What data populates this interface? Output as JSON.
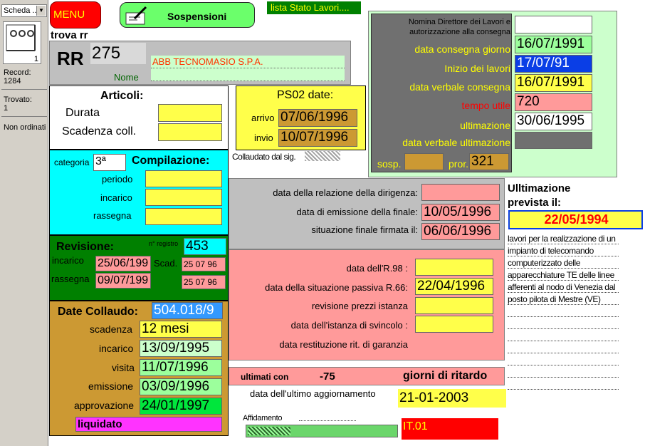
{
  "sidebar": {
    "selector": "Scheda ...",
    "page_number": "1",
    "record_label": "Record:",
    "record_value": "1284",
    "trovato_label": "Trovato:",
    "trovato_value": "1",
    "sort_label": "Non ordinati"
  },
  "header": {
    "menu_label": "MENU",
    "sospensioni_label": "Sospensioni",
    "lista_label": "lista Stato Lavori....",
    "trova_label": "trova rr",
    "rr_label": "RR",
    "rr_value": "275",
    "company": "ABB TECNOMASIO S.P.A.",
    "nome_label": "Nome"
  },
  "articoli": {
    "title": "Articoli:",
    "durata_label": "Durata",
    "durata_value": "",
    "scadenza_label": "Scadenza coll.",
    "scadenza_value": ""
  },
  "ps02": {
    "title": "PS02 date:",
    "arrivo_label": "arrivo",
    "arrivo_value": "07/06/1996",
    "invio_label": "invio",
    "invio_value": "10/07/1996",
    "collaudato_label": "Collaudato dal sig."
  },
  "direttore": {
    "nomina_label": "Nomina Direttore dei Lavori e autorizzazione alla consegna",
    "nomina_value": "",
    "consegna_label": "data consegna giorno",
    "consegna_value": "16/07/1991",
    "inizio_label": "Inizio dei lavori",
    "inizio_value": "17/07/91",
    "verbale_label": "data verbale consegna",
    "verbale_value": "16/07/1991",
    "tempo_label": "tempo utile",
    "tempo_value": "720",
    "ultimazione_label": "ultimazione",
    "ultimazione_value": "30/06/1995",
    "verbale_ult_label": "data verbale ultimazione",
    "verbale_ult_value": "",
    "sosp_label": "sosp.",
    "sosp_value": "",
    "pror_label": "pror.",
    "pror_value": "321"
  },
  "compilazione": {
    "categoria_label": "categoria",
    "categoria_value": "3ª",
    "title": "Compilazione:",
    "periodo_label": "periodo",
    "periodo_value": "",
    "incarico_label": "incarico",
    "incarico_value": "",
    "rassegna_label": "rassegna",
    "rassegna_value": ""
  },
  "relazione": {
    "dirigenza_label": "data della relazione della dirigenza:",
    "dirigenza_value": "",
    "emissione_label": "data di emissione della finale:",
    "emissione_value": "10/05/1996",
    "firmata_label": "situazione finale firmata il:",
    "firmata_value": "06/06/1996"
  },
  "ultimazione_prevista": {
    "title": "Ulltimazione prevista  il:",
    "value": "22/05/1994",
    "description": "lavori per la realizzazione di un impianto di telecomando computerizzato delle apparecchiature TE delle linee afferenti al nodo di Venezia dal posto pilota di Mestre (VE)"
  },
  "revisione": {
    "title": "Revisione:",
    "registro_label": "n° registro",
    "registro_value": "453",
    "incarico_label": "incarico",
    "incarico_value": "25/06/199",
    "scad_label": "Scad.",
    "scad1_value": "25 07 96",
    "rassegna_label": "rassegna",
    "rassegna_value": "09/07/199",
    "scad2_value": "25 07 96"
  },
  "passiva": {
    "r98_label": "data dell'R.98 :",
    "r98_value": "",
    "r66_label": "data della situazione passiva R.66:",
    "r66_value": "22/04/1996",
    "prezzi_label": "revisione prezzi istanza",
    "prezzi_value": "",
    "svincolo_label": "data dell'istanza di svincolo :",
    "svincolo_value": "",
    "garanzia_label": "data restituzione rit. di garanzia"
  },
  "collaudo": {
    "title": "Date Collaudo:",
    "code_value": "504.018/9",
    "scadenza_label": "scadenza",
    "scadenza_value": "12 mesi",
    "incarico_label": "incarico",
    "incarico_value": "13/09/1995",
    "visita_label": "visita",
    "visita_value": "11/07/1996",
    "emissione_label": "emissione",
    "emissione_value": "03/09/1996",
    "approvazione_label": "approvazione",
    "approvazione_value": "24/01/1997",
    "liquidato_label": "liquidato"
  },
  "ritardo": {
    "ultimati_label": "ultimati con",
    "value": "-75",
    "giorni_label": "giorni di ritardo"
  },
  "aggiornamento": {
    "label": "data dell'ultimo aggiornamento",
    "value": "21-01-2003"
  },
  "affidamento": {
    "label": "Affidamento",
    "code": "IT.01"
  },
  "colors": {
    "yellow": "#ffff4a",
    "pink": "#ff9a9a",
    "cyan": "#00ffff",
    "dark_green": "#008000",
    "gold": "#cc9933",
    "gray": "#bfbfbf",
    "dark_gray": "#707070",
    "light_green": "#ccffcc",
    "red": "#ff0000",
    "blue": "#0a3ee6"
  },
  "icons": {
    "ring_binder": "ring-binder-icon",
    "pen": "pen-writing-icon"
  }
}
